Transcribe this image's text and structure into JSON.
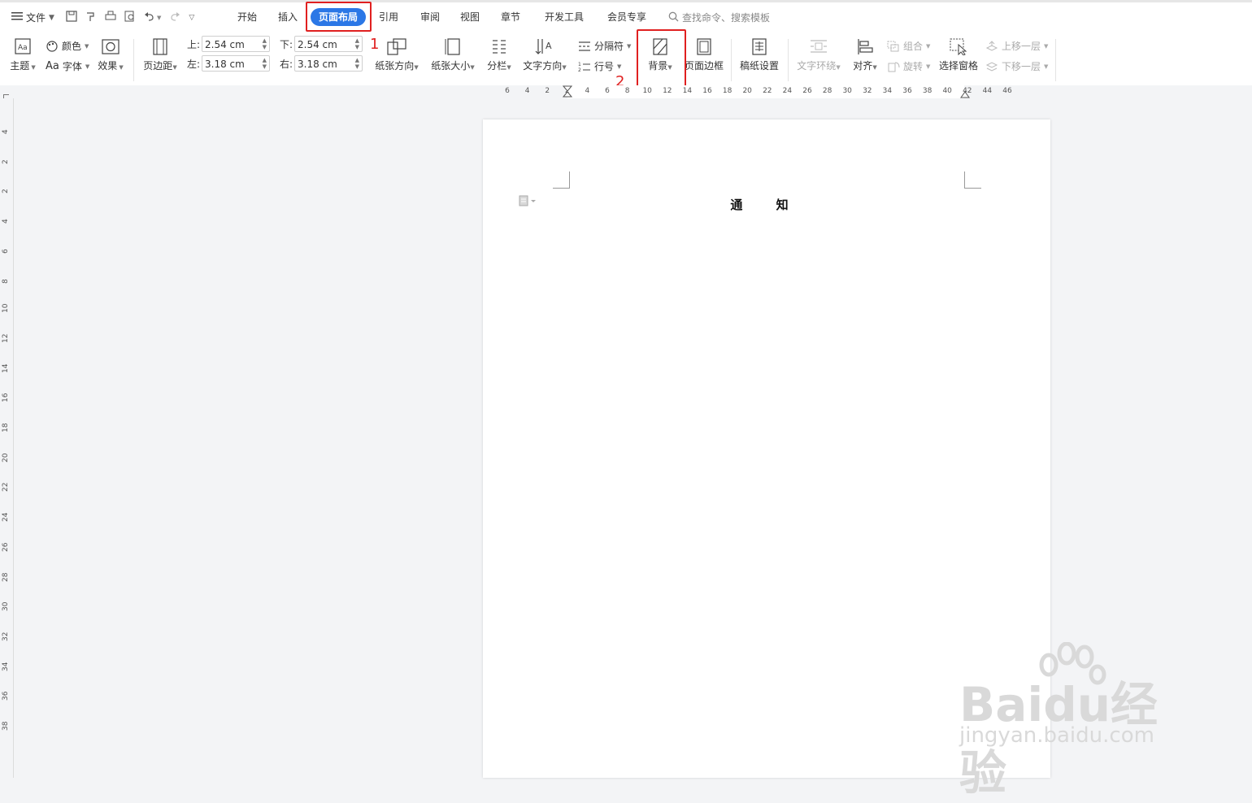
{
  "menu": {
    "file_label": "文件"
  },
  "tabs": [
    {
      "label": "开始"
    },
    {
      "label": "插入"
    },
    {
      "label": "页面布局"
    },
    {
      "label": "引用"
    },
    {
      "label": "审阅"
    },
    {
      "label": "视图"
    },
    {
      "label": "章节"
    },
    {
      "label": "开发工具"
    },
    {
      "label": "会员专享"
    }
  ],
  "search": {
    "placeholder": "查找命令、搜索模板"
  },
  "ribbon": {
    "theme": "主题",
    "color": "颜色",
    "font": "字体",
    "font_prefix": "Aa",
    "effect": "效果",
    "margins": "页边距",
    "top_label": "上:",
    "top_value": "2.54 cm",
    "bottom_label": "下:",
    "bottom_value": "2.54 cm",
    "left_label": "左:",
    "left_value": "3.18 cm",
    "right_label": "右:",
    "right_value": "3.18 cm",
    "orientation": "纸张方向",
    "size": "纸张大小",
    "columns": "分栏",
    "text_direction": "文字方向",
    "separator": "分隔符",
    "line_number": "行号",
    "background": "背景",
    "page_border": "页面边框",
    "manuscript": "稿纸设置",
    "text_wrap": "文字环绕",
    "align": "对齐",
    "group": "组合",
    "rotate": "旋转",
    "selection_pane": "选择窗格",
    "bring_forward": "上移一层",
    "send_backward": "下移一层"
  },
  "annotations": {
    "step1": "1",
    "step2": "2"
  },
  "hruler_ticks": [
    "6",
    "4",
    "2",
    "2",
    "4",
    "6",
    "8",
    "10",
    "12",
    "14",
    "16",
    "18",
    "20",
    "22",
    "24",
    "26",
    "28",
    "30",
    "32",
    "34",
    "36",
    "38",
    "40",
    "42",
    "44",
    "46"
  ],
  "vruler_ticks": [
    "4",
    "2",
    "2",
    "4",
    "6",
    "8",
    "10",
    "12",
    "14",
    "16",
    "18",
    "20",
    "22",
    "24",
    "26",
    "28",
    "30",
    "32",
    "34",
    "36",
    "38"
  ],
  "document": {
    "title": "通 知"
  },
  "watermark": {
    "brand": "Baidu经验",
    "url": "jingyan.baidu.com"
  },
  "colors": {
    "accent": "#2b77e6",
    "highlight": "#e02020"
  }
}
